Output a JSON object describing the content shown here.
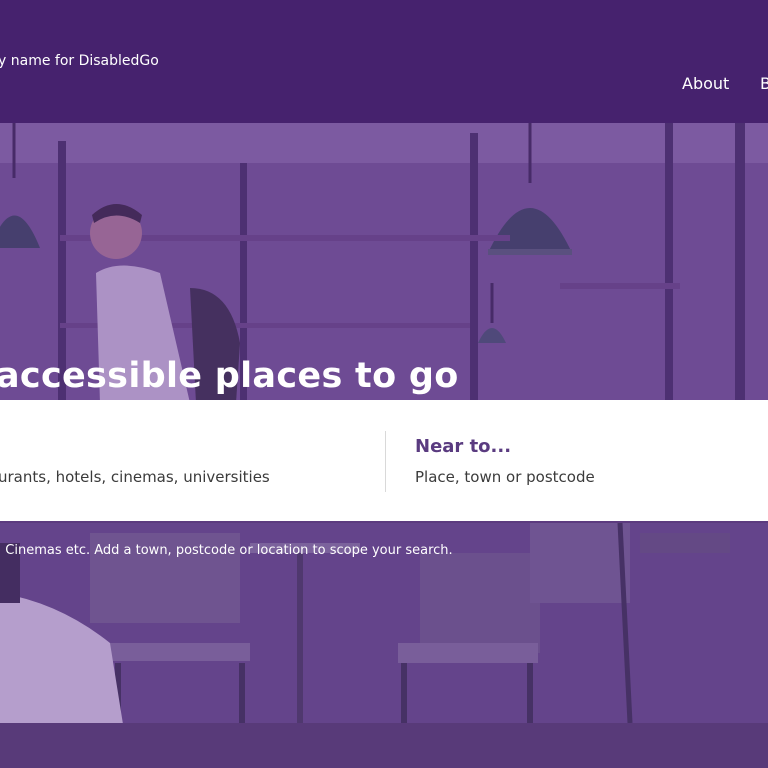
{
  "header": {
    "tagline": "y name for DisabledGo",
    "nav": {
      "about": "About",
      "next_item": "B"
    }
  },
  "hero": {
    "headline": "accessible places to go",
    "helper_text": ", Cinemas etc. Add a town, postcode or location to scope your search."
  },
  "search": {
    "what_placeholder": "urants, hotels, cinemas, universities",
    "near_label": "Near to...",
    "near_placeholder": "Place, town or postcode"
  },
  "colors": {
    "header_bg": "#46226e",
    "overlay": "#582c8c",
    "near_label": "#5a3b80",
    "panel_bg": "#ffffff"
  }
}
